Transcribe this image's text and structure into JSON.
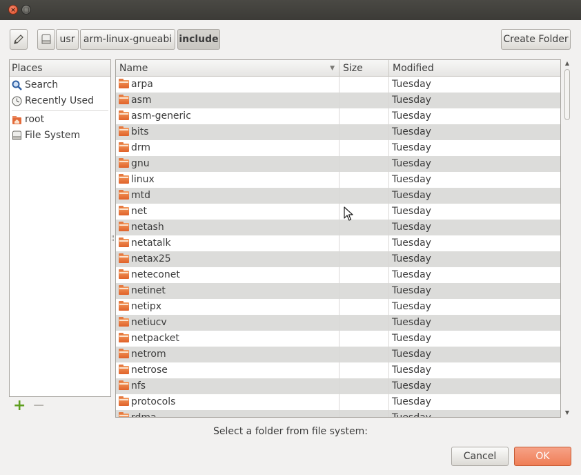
{
  "window": {
    "close_glyph": "×",
    "maximize_glyph": "□"
  },
  "toolbar": {
    "edit_icon": "pencil-icon",
    "drive_icon": "drive-icon",
    "crumbs": [
      "usr",
      "arm-linux-gnueabi",
      "include"
    ],
    "create_folder_label": "Create Folder"
  },
  "places": {
    "header": "Places",
    "items": [
      {
        "label": "Search",
        "icon": "search-icon"
      },
      {
        "label": "Recently Used",
        "icon": "clock-icon"
      },
      {
        "label": "root",
        "icon": "home-folder-icon"
      },
      {
        "label": "File System",
        "icon": "drive-icon"
      }
    ],
    "add_glyph": "+",
    "remove_glyph": "−"
  },
  "files": {
    "columns": {
      "name": "Name",
      "size": "Size",
      "modified": "Modified"
    },
    "sort_glyph": "▼",
    "rows": [
      {
        "name": "arpa",
        "size": "",
        "modified": "Tuesday"
      },
      {
        "name": "asm",
        "size": "",
        "modified": "Tuesday"
      },
      {
        "name": "asm-generic",
        "size": "",
        "modified": "Tuesday"
      },
      {
        "name": "bits",
        "size": "",
        "modified": "Tuesday"
      },
      {
        "name": "drm",
        "size": "",
        "modified": "Tuesday"
      },
      {
        "name": "gnu",
        "size": "",
        "modified": "Tuesday"
      },
      {
        "name": "linux",
        "size": "",
        "modified": "Tuesday"
      },
      {
        "name": "mtd",
        "size": "",
        "modified": "Tuesday"
      },
      {
        "name": "net",
        "size": "",
        "modified": "Tuesday"
      },
      {
        "name": "netash",
        "size": "",
        "modified": "Tuesday"
      },
      {
        "name": "netatalk",
        "size": "",
        "modified": "Tuesday"
      },
      {
        "name": "netax25",
        "size": "",
        "modified": "Tuesday"
      },
      {
        "name": "neteconet",
        "size": "",
        "modified": "Tuesday"
      },
      {
        "name": "netinet",
        "size": "",
        "modified": "Tuesday"
      },
      {
        "name": "netipx",
        "size": "",
        "modified": "Tuesday"
      },
      {
        "name": "netiucv",
        "size": "",
        "modified": "Tuesday"
      },
      {
        "name": "netpacket",
        "size": "",
        "modified": "Tuesday"
      },
      {
        "name": "netrom",
        "size": "",
        "modified": "Tuesday"
      },
      {
        "name": "netrose",
        "size": "",
        "modified": "Tuesday"
      },
      {
        "name": "nfs",
        "size": "",
        "modified": "Tuesday"
      },
      {
        "name": "protocols",
        "size": "",
        "modified": "Tuesday"
      },
      {
        "name": "rdma",
        "size": "",
        "modified": "Tuesday"
      }
    ]
  },
  "footer": {
    "hint": "Select a folder from file system:",
    "cancel_label": "Cancel",
    "ok_label": "OK"
  }
}
